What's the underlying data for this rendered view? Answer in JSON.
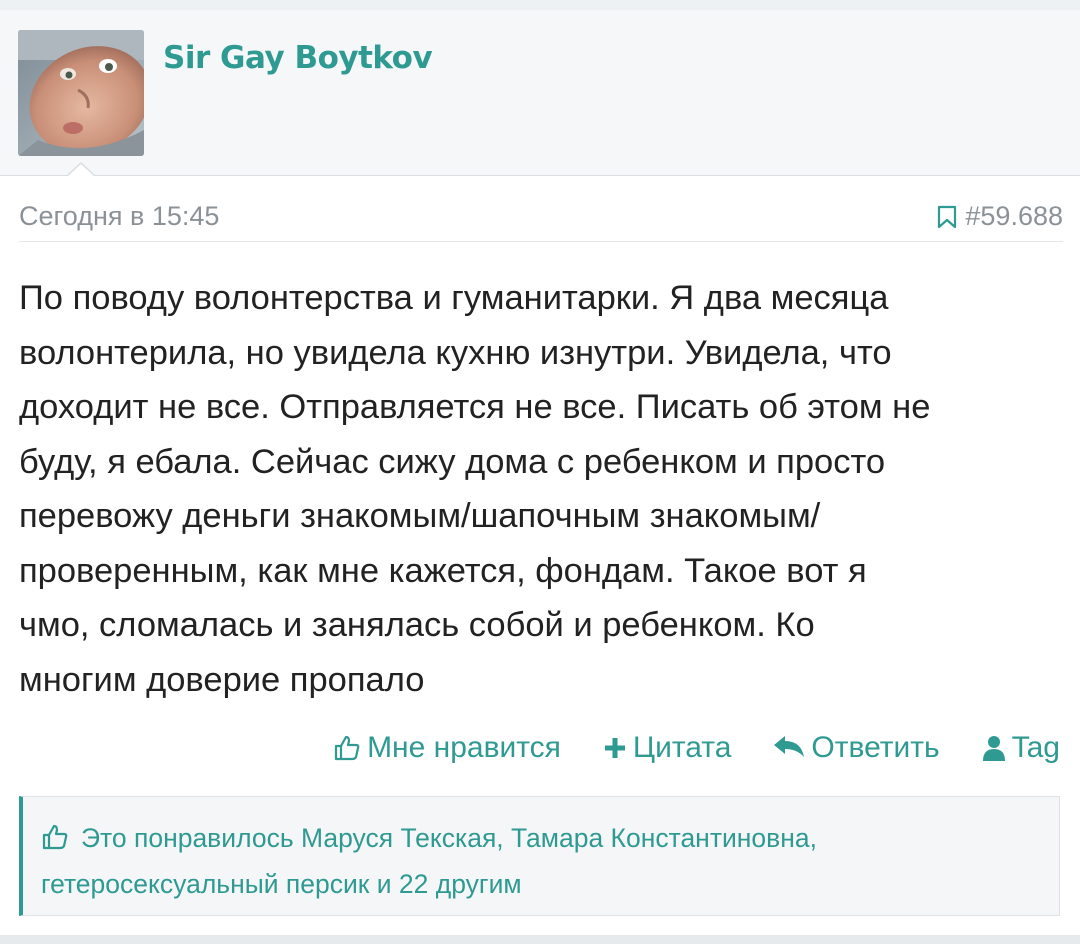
{
  "post": {
    "author": "Sir Gay Boytkov",
    "date": "Сегодня в 15:45",
    "number": "#59.688",
    "body": "По поводу волонтерства и гуманитарки. Я два месяца\nволонтерила, но увидела кухню изнутри. Увидела, что\nдоходит не все. Отправляется не все. Писать об этом не\nбуду, я ебала. Сейчас сижу дома с ребенком и просто\nперевожу деньги знакомым/шапочным знакомым/\nпроверенным, как мне кажется, фондам. Такое вот я\nчмо, сломалась и занялась собой и ребенком. Ко\nмногим доверие пропало"
  },
  "actions": {
    "like": "Мне нравится",
    "quote": "Цитата",
    "reply": "Ответить",
    "tag": "Tag"
  },
  "likes": {
    "text": "Это понравилось Маруся Текская, Тамара Константиновна, гетеросексуальный персик и 22 другим"
  },
  "icons": {
    "like": "thumbs-up-icon",
    "quote": "plus-icon",
    "reply": "reply-icon",
    "tag": "user-icon",
    "bookmark": "bookmark-icon"
  },
  "colors": {
    "accent": "#2f9a92",
    "text": "#222222",
    "muted": "#8b9297"
  }
}
